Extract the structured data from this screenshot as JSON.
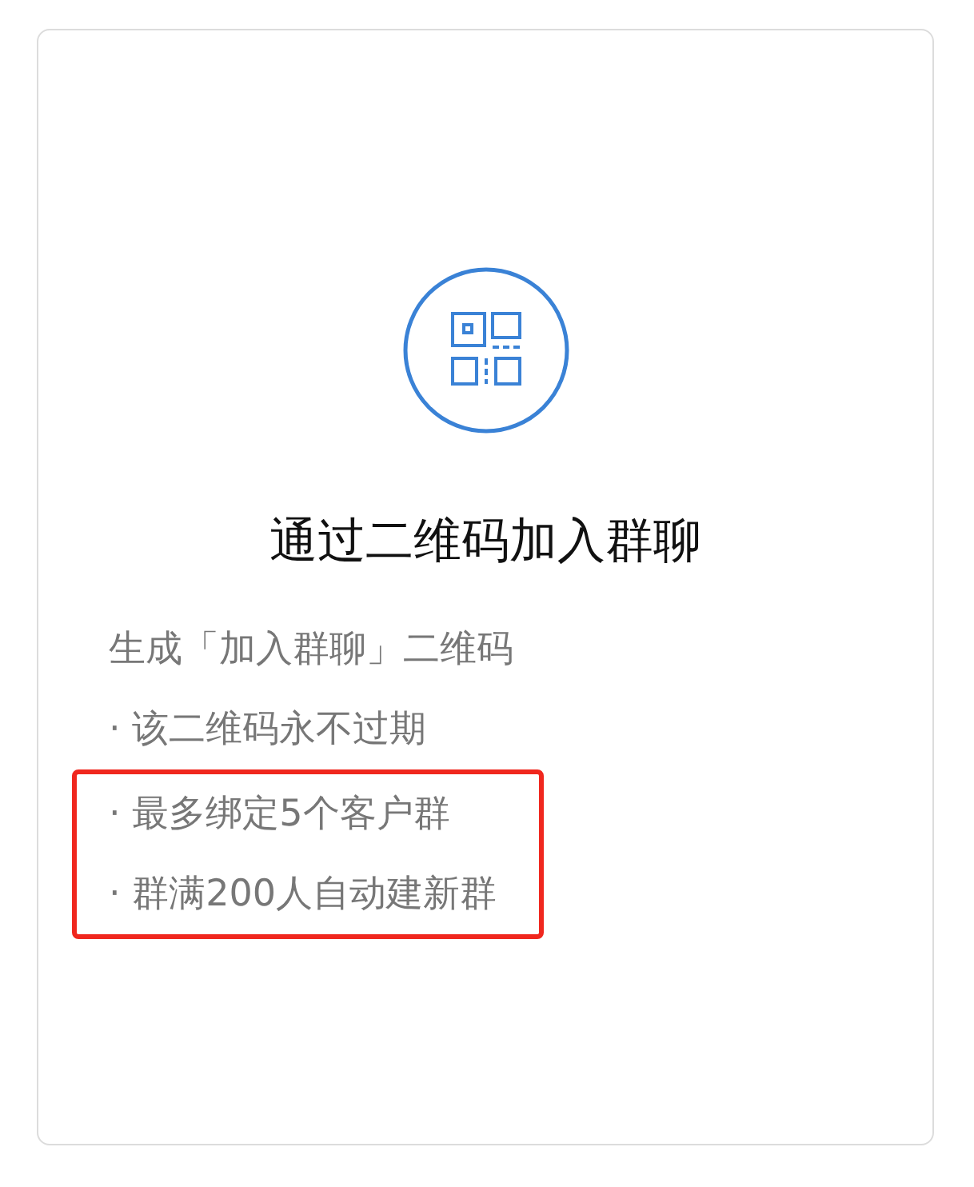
{
  "card": {
    "title": "通过二维码加入群聊",
    "lines": [
      {
        "text": "生成「加入群聊」二维码",
        "highlighted": false
      },
      {
        "text": "· 该二维码永不过期",
        "highlighted": false
      },
      {
        "text": "· 最多绑定5个客户群",
        "highlighted": true
      },
      {
        "text": "· 群满200人自动建新群",
        "highlighted": true
      }
    ]
  }
}
